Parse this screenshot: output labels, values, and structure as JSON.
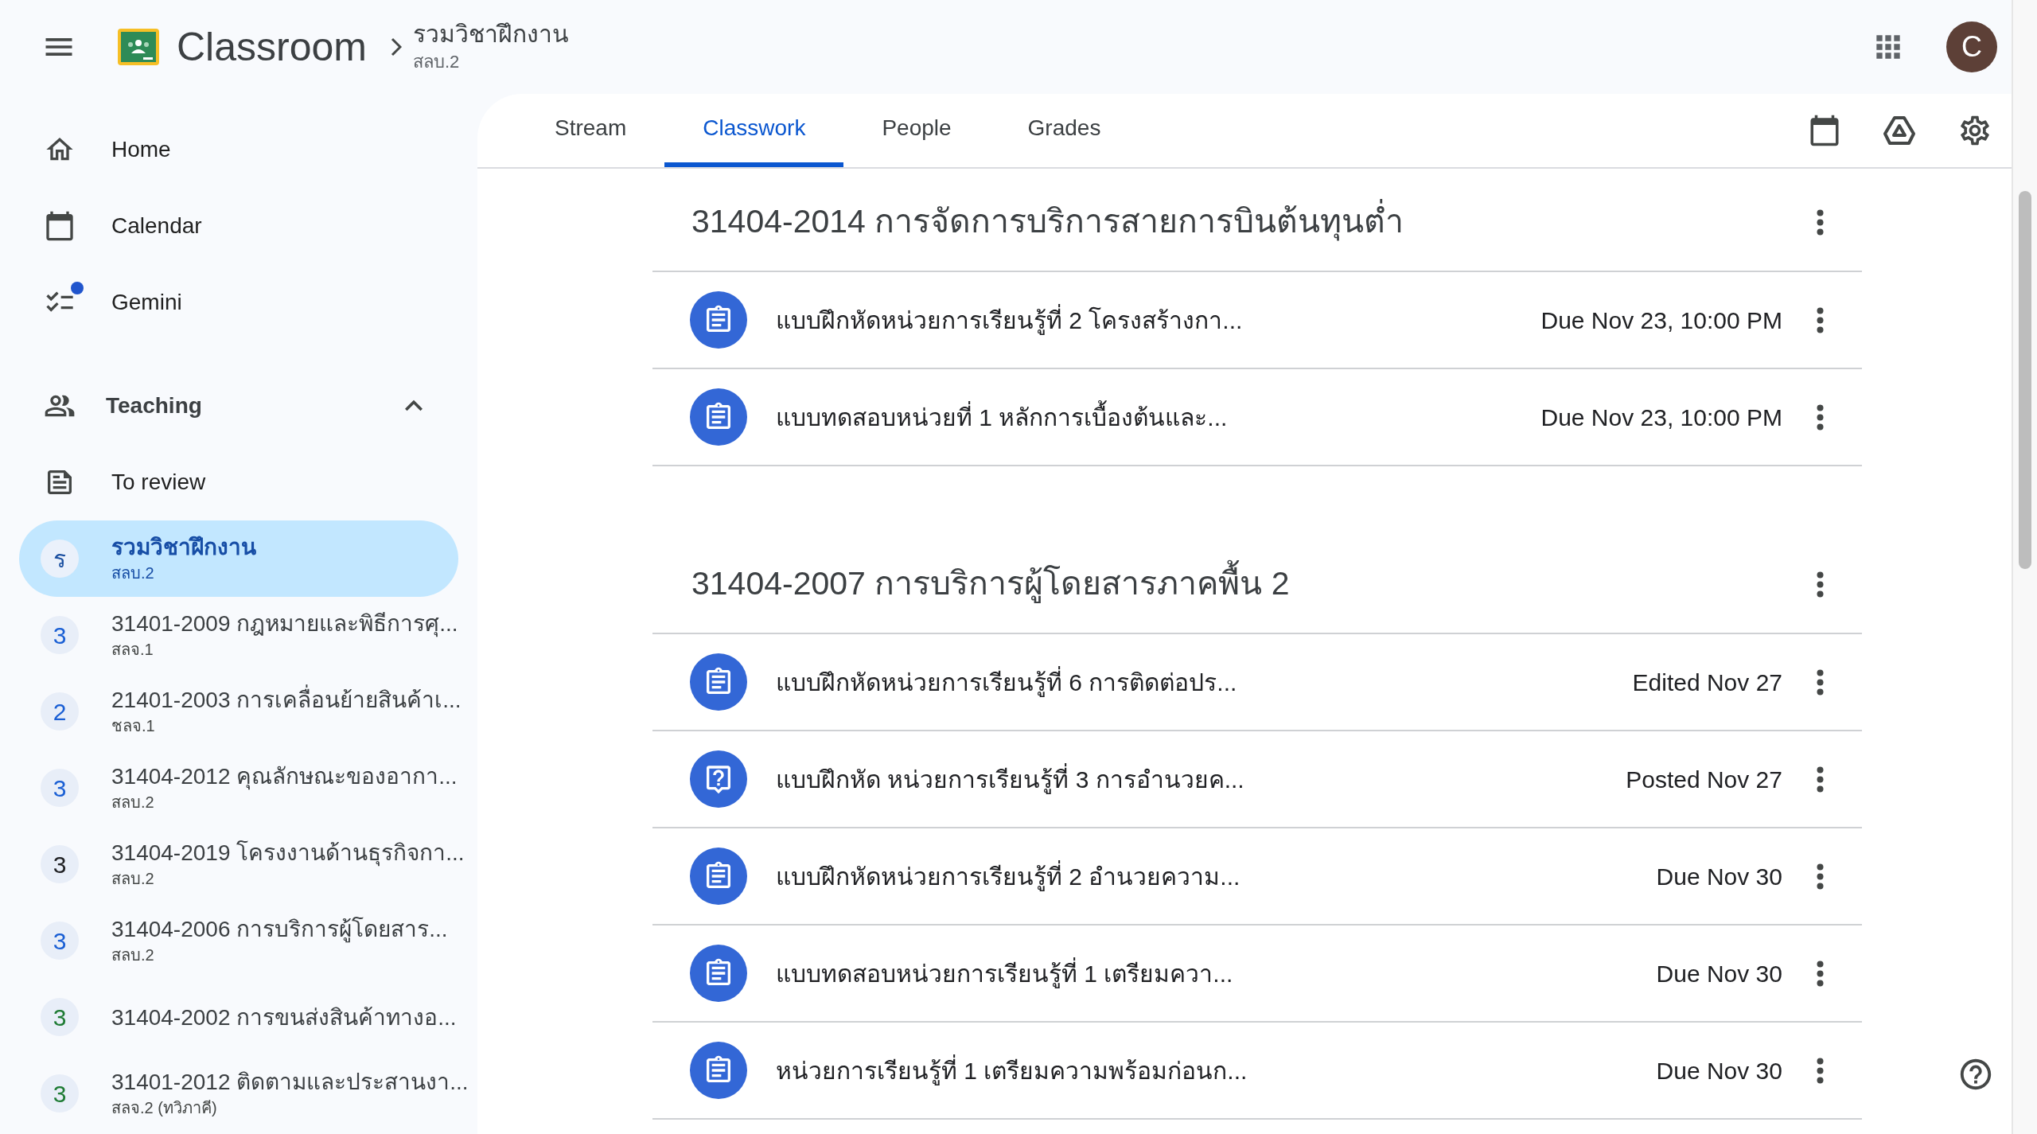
{
  "header": {
    "app_name": "Classroom",
    "class_title": "รวมวิชาฝึกงาน",
    "class_section": "สลบ.2",
    "avatar_initial": "C"
  },
  "nav": [
    {
      "kind": "home",
      "label": "Home",
      "notification": false
    },
    {
      "kind": "calendar",
      "label": "Calendar",
      "notification": false
    },
    {
      "kind": "gemini",
      "label": "Gemini",
      "notification": true
    }
  ],
  "teaching": {
    "label": "Teaching",
    "expanded": true,
    "to_review": "To review",
    "courses": [
      {
        "initial": "ร",
        "title": "รวมวิชาฝึกงาน",
        "section": "สลบ.2",
        "color": "#1a4fa0",
        "selected": true
      },
      {
        "initial": "3",
        "title": "31401-2009 กฎหมายและพิธีการศุ...",
        "section": "สลจ.1",
        "color": "#1a5fd4",
        "selected": false
      },
      {
        "initial": "2",
        "title": "21401-2003 การเคลื่อนย้ายสินค้าเ...",
        "section": "ชลจ.1",
        "color": "#1a5fd4",
        "selected": false
      },
      {
        "initial": "3",
        "title": "31404-2012 คุณลักษณะของอากา...",
        "section": "สลบ.2",
        "color": "#1a5fd4",
        "selected": false
      },
      {
        "initial": "3",
        "title": "31404-2019 โครงงานด้านธุรกิจกา...",
        "section": "สลบ.2",
        "color": "#202124",
        "selected": false
      },
      {
        "initial": "3",
        "title": "31404-2006 การบริการผู้โดยสาร...",
        "section": "สลบ.2",
        "color": "#1a5fd4",
        "selected": false
      },
      {
        "initial": "3",
        "title": "31404-2002 การขนส่งสินค้าทางอ...",
        "color": "#1e7b34",
        "selected": false
      },
      {
        "initial": "3",
        "title": "31401-2012 ติดตามและประสานงา...",
        "section": "สลจ.2 (ทวิภาคี)",
        "color": "#1e7b34",
        "selected": false
      }
    ]
  },
  "tabs": [
    {
      "label": "Stream",
      "selected": false
    },
    {
      "label": "Classwork",
      "selected": true
    },
    {
      "label": "People",
      "selected": false
    },
    {
      "label": "Grades",
      "selected": false
    }
  ],
  "sections": [
    {
      "title": "31404-2014 การจัดการบริการสายการบินต้นทุนต่ำ",
      "items": [
        {
          "kind": "assignment",
          "title": "แบบฝึกหัดหน่วยการเรียนรู้ที่ 2 โครงสร้างกา...",
          "status": "Due Nov 23, 10:00 PM"
        },
        {
          "kind": "assignment",
          "title": "แบบทดสอบหน่วยที่ 1 หลักการเบื้องต้นและ...",
          "status": "Due Nov 23, 10:00 PM"
        }
      ]
    },
    {
      "title": "31404-2007 การบริการผู้โดยสารภาคพื้น 2",
      "items": [
        {
          "kind": "assignment",
          "title": "แบบฝึกหัดหน่วยการเรียนรู้ที่ 6 การติดต่อปร...",
          "status": "Edited Nov 27"
        },
        {
          "kind": "question",
          "title": "แบบฝึกหัด หน่วยการเรียนรู้ที่ 3 การอำนวยค...",
          "status": "Posted Nov 27"
        },
        {
          "kind": "assignment",
          "title": "แบบฝึกหัดหน่วยการเรียนรู้ที่ 2 อำนวยความ...",
          "status": "Due Nov 30"
        },
        {
          "kind": "assignment",
          "title": "แบบทดสอบหน่วยการเรียนรู้ที่ 1 เตรียมควา...",
          "status": "Due Nov 30"
        },
        {
          "kind": "assignment",
          "title": "หน่วยการเรียนรู้ที่ 1 เตรียมความพร้อมก่อนก...",
          "status": "Due Nov 30"
        }
      ]
    }
  ]
}
